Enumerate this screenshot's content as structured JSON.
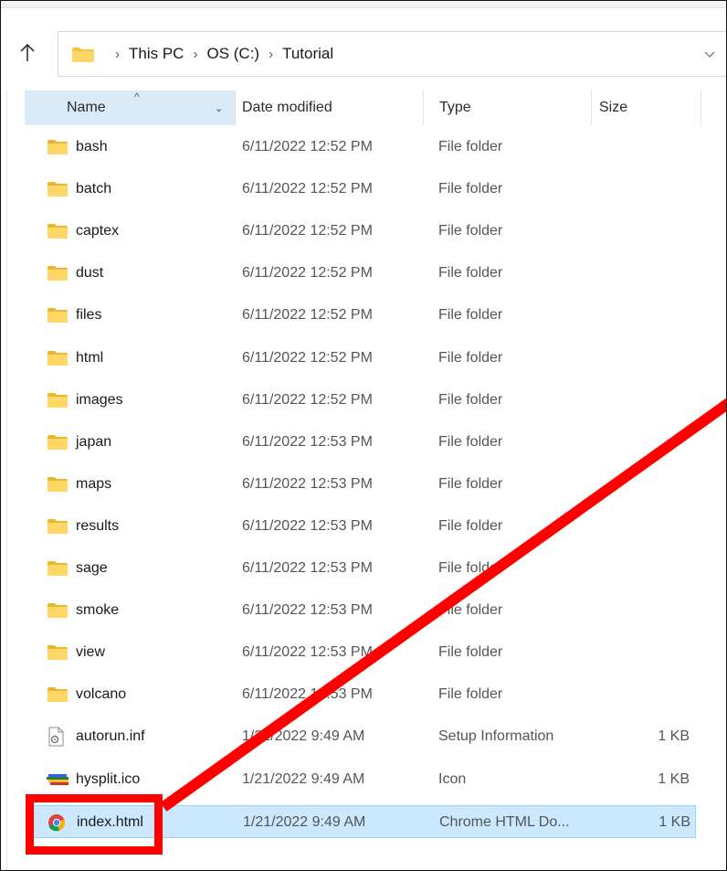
{
  "address_bar": {
    "breadcrumbs": [
      "This PC",
      "OS (C:)",
      "Tutorial"
    ],
    "separator": "›",
    "up_icon": "arrow-up-icon",
    "dropdown_icon": "chevron-down-icon"
  },
  "columns": {
    "name": "Name",
    "date": "Date modified",
    "type": "Type",
    "size": "Size",
    "sort_indicator": "^",
    "dropdown": "⌄"
  },
  "colors": {
    "folder": "#f5c542",
    "selection": "#cce8ff",
    "annotation": "#ff0000"
  },
  "files": [
    {
      "name": "bash",
      "date": "6/11/2022 12:52 PM",
      "type": "File folder",
      "size": "",
      "icon": "folder-icon"
    },
    {
      "name": "batch",
      "date": "6/11/2022 12:52 PM",
      "type": "File folder",
      "size": "",
      "icon": "folder-icon"
    },
    {
      "name": "captex",
      "date": "6/11/2022 12:52 PM",
      "type": "File folder",
      "size": "",
      "icon": "folder-icon"
    },
    {
      "name": "dust",
      "date": "6/11/2022 12:52 PM",
      "type": "File folder",
      "size": "",
      "icon": "folder-icon"
    },
    {
      "name": "files",
      "date": "6/11/2022 12:52 PM",
      "type": "File folder",
      "size": "",
      "icon": "folder-icon"
    },
    {
      "name": "html",
      "date": "6/11/2022 12:52 PM",
      "type": "File folder",
      "size": "",
      "icon": "folder-icon"
    },
    {
      "name": "images",
      "date": "6/11/2022 12:52 PM",
      "type": "File folder",
      "size": "",
      "icon": "folder-icon"
    },
    {
      "name": "japan",
      "date": "6/11/2022 12:53 PM",
      "type": "File folder",
      "size": "",
      "icon": "folder-icon"
    },
    {
      "name": "maps",
      "date": "6/11/2022 12:53 PM",
      "type": "File folder",
      "size": "",
      "icon": "folder-icon"
    },
    {
      "name": "results",
      "date": "6/11/2022 12:53 PM",
      "type": "File folder",
      "size": "",
      "icon": "folder-icon"
    },
    {
      "name": "sage",
      "date": "6/11/2022 12:53 PM",
      "type": "File folder",
      "size": "",
      "icon": "folder-icon"
    },
    {
      "name": "smoke",
      "date": "6/11/2022 12:53 PM",
      "type": "File folder",
      "size": "",
      "icon": "folder-icon"
    },
    {
      "name": "view",
      "date": "6/11/2022 12:53 PM",
      "type": "File folder",
      "size": "",
      "icon": "folder-icon"
    },
    {
      "name": "volcano",
      "date": "6/11/2022 12:53 PM",
      "type": "File folder",
      "size": "",
      "icon": "folder-icon"
    },
    {
      "name": "autorun.inf",
      "date": "1/21/2022 9:49 AM",
      "type": "Setup Information",
      "size": "1 KB",
      "icon": "settings-file-icon"
    },
    {
      "name": "hysplit.ico",
      "date": "1/21/2022 9:49 AM",
      "type": "Icon",
      "size": "1 KB",
      "icon": "ico-file-icon"
    },
    {
      "name": "index.html",
      "date": "1/21/2022 9:49 AM",
      "type": "Chrome HTML Do...",
      "size": "1 KB",
      "icon": "chrome-icon",
      "selected": true
    }
  ]
}
